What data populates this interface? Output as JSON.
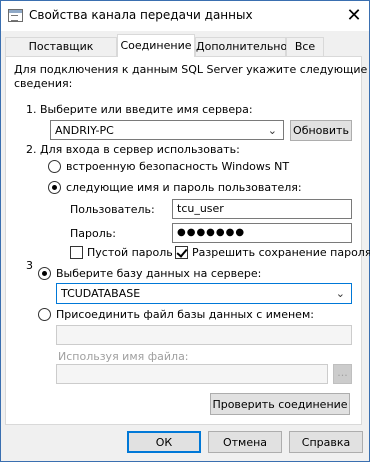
{
  "window": {
    "title": "Свойства канала передачи данных",
    "close_glyph": "✕"
  },
  "tabs": [
    {
      "label": "Поставщик данных"
    },
    {
      "label": "Соединение"
    },
    {
      "label": "Дополнительно"
    },
    {
      "label": "Все"
    }
  ],
  "intro": {
    "line1": "Для подключения к данным SQL Server укажите следующие",
    "line2": "сведения:"
  },
  "step1": {
    "label": "1. Выберите или введите имя сервера:",
    "server_value": "ANDRIY-PC",
    "refresh_label": "Обновить"
  },
  "step2": {
    "label": "2. Для входа в сервер использовать:",
    "option_nt": "встроенную безопасность Windows NT",
    "option_user": "следующие имя и пароль пользователя:",
    "user_label": "Пользователь:",
    "user_value": "tcu_user",
    "password_label": "Пароль:",
    "password_value": "●●●●●●●",
    "blank_password": "Пустой пароль",
    "allow_save": "Разрешить сохранение пароля"
  },
  "step3": {
    "number": "3",
    "option_db": "Выберите базу данных на сервере:",
    "db_value": "TCUDATABASE",
    "option_attach": "Присоединить файл базы данных с именем:",
    "attach_value": "",
    "logical_name_label": "Используя имя файла:",
    "logical_name_value": "",
    "browse_label": "..."
  },
  "test_button": "Проверить соединение",
  "footer": {
    "ok": "ОК",
    "cancel": "Отмена",
    "help": "Справка"
  },
  "colors": {
    "accent": "#0078d7",
    "window_border": "#3a6fb0"
  }
}
